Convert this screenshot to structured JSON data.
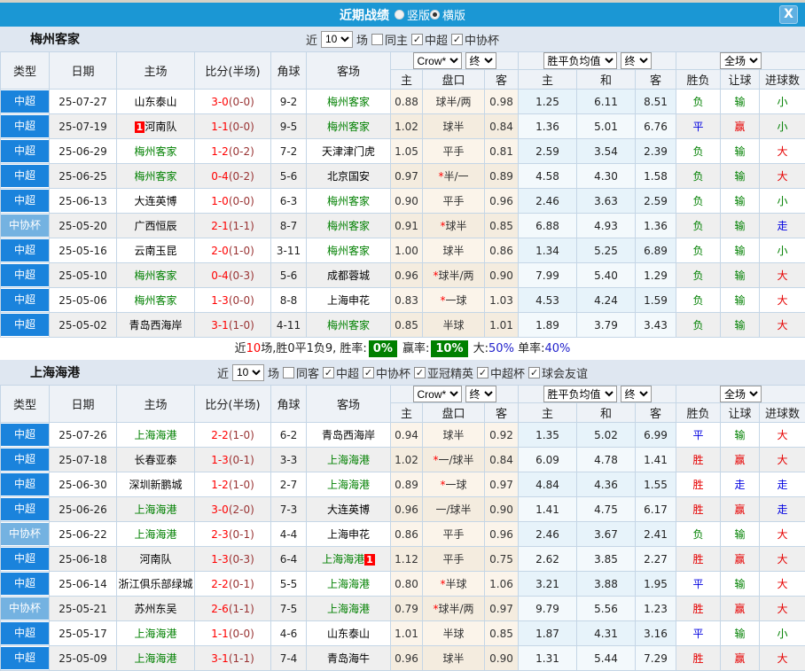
{
  "colors": {
    "titlebar": "#1b97d4",
    "league_csl": "#1a83dc",
    "league_cup": "#74b2e1",
    "team_green": "#008000",
    "score_red": "#ff0000",
    "half_red": "#993333",
    "win_red": "#e60000",
    "draw_blue": "#0000e0",
    "lose_green": "#008000",
    "summary_badge_bg": "#008000",
    "section_header_bg": "#dfe7f1"
  },
  "titlebar": {
    "title": "近期战绩",
    "radio_options": [
      {
        "label": "竖版",
        "selected": false
      },
      {
        "label": "横版",
        "selected": true
      }
    ],
    "close_icon": "X"
  },
  "columns": [
    "类型",
    "日期",
    "主场",
    "比分(半场)",
    "角球",
    "客场",
    "主",
    "盘口",
    "客",
    "主",
    "和",
    "客",
    "胜负",
    "让球",
    "进球数"
  ],
  "dropdowns": {
    "odds_provider": "Crow*",
    "odds_state": "终",
    "mean": "胜平负均值",
    "mean_state": "终",
    "scope": "全场"
  },
  "filter_labels": {
    "prefix": "近",
    "suffix": "场"
  },
  "sections": [
    {
      "team": "梅州客家",
      "filter": {
        "count": "10",
        "checks": [
          {
            "label": "同主",
            "checked": false
          },
          {
            "label": "中超",
            "checked": true
          },
          {
            "label": "中协杯",
            "checked": true
          }
        ]
      },
      "rows": [
        {
          "league": "中超",
          "cup": false,
          "date": "25-07-27",
          "home": {
            "name": "山东泰山",
            "green": false
          },
          "score": "3-0",
          "half": "(0-0)",
          "corner": "9-2",
          "away": {
            "name": "梅州客家",
            "green": true
          },
          "o1": "0.88",
          "star": false,
          "hcap": "球半/两",
          "o2": "0.98",
          "m1": "1.25",
          "m2": "6.11",
          "m3": "8.51",
          "r1": {
            "t": "负",
            "c": "green"
          },
          "r2": {
            "t": "输",
            "c": "green"
          },
          "r3": {
            "t": "小",
            "c": "green"
          }
        },
        {
          "league": "中超",
          "cup": false,
          "date": "25-07-19",
          "home": {
            "name": "河南队",
            "green": false,
            "tag": "1",
            "tagPos": "pre"
          },
          "score": "1-1",
          "half": "(0-0)",
          "corner": "9-5",
          "away": {
            "name": "梅州客家",
            "green": true
          },
          "o1": "1.02",
          "star": false,
          "hcap": "球半",
          "o2": "0.84",
          "m1": "1.36",
          "m2": "5.01",
          "m3": "6.76",
          "r1": {
            "t": "平",
            "c": "blue"
          },
          "r2": {
            "t": "赢",
            "c": "red"
          },
          "r3": {
            "t": "小",
            "c": "green"
          }
        },
        {
          "league": "中超",
          "cup": false,
          "date": "25-06-29",
          "home": {
            "name": "梅州客家",
            "green": true
          },
          "score": "1-2",
          "half": "(0-2)",
          "corner": "7-2",
          "away": {
            "name": "天津津门虎",
            "green": false
          },
          "o1": "1.05",
          "star": false,
          "hcap": "平手",
          "o2": "0.81",
          "m1": "2.59",
          "m2": "3.54",
          "m3": "2.39",
          "r1": {
            "t": "负",
            "c": "green"
          },
          "r2": {
            "t": "输",
            "c": "green"
          },
          "r3": {
            "t": "大",
            "c": "red"
          }
        },
        {
          "league": "中超",
          "cup": false,
          "date": "25-06-25",
          "home": {
            "name": "梅州客家",
            "green": true
          },
          "score": "0-4",
          "half": "(0-2)",
          "corner": "5-6",
          "away": {
            "name": "北京国安",
            "green": false
          },
          "o1": "0.97",
          "star": true,
          "hcap": "半/一",
          "o2": "0.89",
          "m1": "4.58",
          "m2": "4.30",
          "m3": "1.58",
          "r1": {
            "t": "负",
            "c": "green"
          },
          "r2": {
            "t": "输",
            "c": "green"
          },
          "r3": {
            "t": "大",
            "c": "red"
          }
        },
        {
          "league": "中超",
          "cup": false,
          "date": "25-06-13",
          "home": {
            "name": "大连英博",
            "green": false
          },
          "score": "1-0",
          "half": "(0-0)",
          "corner": "6-3",
          "away": {
            "name": "梅州客家",
            "green": true
          },
          "o1": "0.90",
          "star": false,
          "hcap": "平手",
          "o2": "0.96",
          "m1": "2.46",
          "m2": "3.63",
          "m3": "2.59",
          "r1": {
            "t": "负",
            "c": "green"
          },
          "r2": {
            "t": "输",
            "c": "green"
          },
          "r3": {
            "t": "小",
            "c": "green"
          }
        },
        {
          "league": "中协杯",
          "cup": true,
          "date": "25-05-20",
          "home": {
            "name": "广西恒辰",
            "green": false
          },
          "score": "2-1",
          "half": "(1-1)",
          "corner": "8-7",
          "away": {
            "name": "梅州客家",
            "green": true
          },
          "o1": "0.91",
          "star": true,
          "hcap": "球半",
          "o2": "0.85",
          "m1": "6.88",
          "m2": "4.93",
          "m3": "1.36",
          "r1": {
            "t": "负",
            "c": "green"
          },
          "r2": {
            "t": "输",
            "c": "green"
          },
          "r3": {
            "t": "走",
            "c": "blue"
          }
        },
        {
          "league": "中超",
          "cup": false,
          "date": "25-05-16",
          "home": {
            "name": "云南玉昆",
            "green": false
          },
          "score": "2-0",
          "half": "(1-0)",
          "corner": "3-11",
          "away": {
            "name": "梅州客家",
            "green": true
          },
          "o1": "1.00",
          "star": false,
          "hcap": "球半",
          "o2": "0.86",
          "m1": "1.34",
          "m2": "5.25",
          "m3": "6.89",
          "r1": {
            "t": "负",
            "c": "green"
          },
          "r2": {
            "t": "输",
            "c": "green"
          },
          "r3": {
            "t": "小",
            "c": "green"
          }
        },
        {
          "league": "中超",
          "cup": false,
          "date": "25-05-10",
          "home": {
            "name": "梅州客家",
            "green": true
          },
          "score": "0-4",
          "half": "(0-3)",
          "corner": "5-6",
          "away": {
            "name": "成都蓉城",
            "green": false
          },
          "o1": "0.96",
          "star": true,
          "hcap": "球半/两",
          "o2": "0.90",
          "m1": "7.99",
          "m2": "5.40",
          "m3": "1.29",
          "r1": {
            "t": "负",
            "c": "green"
          },
          "r2": {
            "t": "输",
            "c": "green"
          },
          "r3": {
            "t": "大",
            "c": "red"
          }
        },
        {
          "league": "中超",
          "cup": false,
          "date": "25-05-06",
          "home": {
            "name": "梅州客家",
            "green": true
          },
          "score": "1-3",
          "half": "(0-0)",
          "corner": "8-8",
          "away": {
            "name": "上海申花",
            "green": false
          },
          "o1": "0.83",
          "star": true,
          "hcap": "一球",
          "o2": "1.03",
          "m1": "4.53",
          "m2": "4.24",
          "m3": "1.59",
          "r1": {
            "t": "负",
            "c": "green"
          },
          "r2": {
            "t": "输",
            "c": "green"
          },
          "r3": {
            "t": "大",
            "c": "red"
          }
        },
        {
          "league": "中超",
          "cup": false,
          "date": "25-05-02",
          "home": {
            "name": "青岛西海岸",
            "green": false
          },
          "score": "3-1",
          "half": "(1-0)",
          "corner": "4-11",
          "away": {
            "name": "梅州客家",
            "green": true
          },
          "o1": "0.85",
          "star": false,
          "hcap": "半球",
          "o2": "1.01",
          "m1": "1.89",
          "m2": "3.79",
          "m3": "3.43",
          "r1": {
            "t": "负",
            "c": "green"
          },
          "r2": {
            "t": "输",
            "c": "green"
          },
          "r3": {
            "t": "大",
            "c": "red"
          }
        }
      ],
      "summary": [
        {
          "t": "近",
          "s": "plain"
        },
        {
          "t": "10",
          "s": "red"
        },
        {
          "t": "场,胜0平1负9, 胜率:",
          "s": "plain"
        },
        {
          "t": "0%",
          "s": "pct"
        },
        {
          "t": " 赢率:",
          "s": "plain"
        },
        {
          "t": "10%",
          "s": "pct"
        },
        {
          "t": " 大:",
          "s": "plain"
        },
        {
          "t": "50%",
          "s": "blue"
        },
        {
          "t": " 单率:",
          "s": "plain"
        },
        {
          "t": "40%",
          "s": "blue"
        }
      ]
    },
    {
      "team": "上海海港",
      "filter": {
        "count": "10",
        "checks": [
          {
            "label": "同客",
            "checked": false
          },
          {
            "label": "中超",
            "checked": true
          },
          {
            "label": "中协杯",
            "checked": true
          },
          {
            "label": "亚冠精英",
            "checked": true
          },
          {
            "label": "中超杯",
            "checked": true
          },
          {
            "label": "球会友谊",
            "checked": true
          }
        ]
      },
      "rows": [
        {
          "league": "中超",
          "cup": false,
          "date": "25-07-26",
          "home": {
            "name": "上海海港",
            "green": true
          },
          "score": "2-2",
          "half": "(1-0)",
          "corner": "6-2",
          "away": {
            "name": "青岛西海岸",
            "green": false
          },
          "o1": "0.94",
          "star": false,
          "hcap": "球半",
          "o2": "0.92",
          "m1": "1.35",
          "m2": "5.02",
          "m3": "6.99",
          "r1": {
            "t": "平",
            "c": "blue"
          },
          "r2": {
            "t": "输",
            "c": "green"
          },
          "r3": {
            "t": "大",
            "c": "red"
          }
        },
        {
          "league": "中超",
          "cup": false,
          "date": "25-07-18",
          "home": {
            "name": "长春亚泰",
            "green": false
          },
          "score": "1-3",
          "half": "(0-1)",
          "corner": "3-3",
          "away": {
            "name": "上海海港",
            "green": true
          },
          "o1": "1.02",
          "star": true,
          "hcap": "一/球半",
          "o2": "0.84",
          "m1": "6.09",
          "m2": "4.78",
          "m3": "1.41",
          "r1": {
            "t": "胜",
            "c": "red"
          },
          "r2": {
            "t": "赢",
            "c": "red"
          },
          "r3": {
            "t": "大",
            "c": "red"
          }
        },
        {
          "league": "中超",
          "cup": false,
          "date": "25-06-30",
          "home": {
            "name": "深圳新鹏城",
            "green": false
          },
          "score": "1-2",
          "half": "(1-0)",
          "corner": "2-7",
          "away": {
            "name": "上海海港",
            "green": true
          },
          "o1": "0.89",
          "star": true,
          "hcap": "一球",
          "o2": "0.97",
          "m1": "4.84",
          "m2": "4.36",
          "m3": "1.55",
          "r1": {
            "t": "胜",
            "c": "red"
          },
          "r2": {
            "t": "走",
            "c": "blue"
          },
          "r3": {
            "t": "走",
            "c": "blue"
          }
        },
        {
          "league": "中超",
          "cup": false,
          "date": "25-06-26",
          "home": {
            "name": "上海海港",
            "green": true
          },
          "score": "3-0",
          "half": "(2-0)",
          "corner": "7-3",
          "away": {
            "name": "大连英博",
            "green": false
          },
          "o1": "0.96",
          "star": false,
          "hcap": "一/球半",
          "o2": "0.90",
          "m1": "1.41",
          "m2": "4.75",
          "m3": "6.17",
          "r1": {
            "t": "胜",
            "c": "red"
          },
          "r2": {
            "t": "赢",
            "c": "red"
          },
          "r3": {
            "t": "走",
            "c": "blue"
          }
        },
        {
          "league": "中协杯",
          "cup": true,
          "date": "25-06-22",
          "home": {
            "name": "上海海港",
            "green": true
          },
          "score": "2-3",
          "half": "(0-1)",
          "corner": "4-4",
          "away": {
            "name": "上海申花",
            "green": false
          },
          "o1": "0.86",
          "star": false,
          "hcap": "平手",
          "o2": "0.96",
          "m1": "2.46",
          "m2": "3.67",
          "m3": "2.41",
          "r1": {
            "t": "负",
            "c": "green"
          },
          "r2": {
            "t": "输",
            "c": "green"
          },
          "r3": {
            "t": "大",
            "c": "red"
          }
        },
        {
          "league": "中超",
          "cup": false,
          "date": "25-06-18",
          "home": {
            "name": "河南队",
            "green": false
          },
          "score": "1-3",
          "half": "(0-3)",
          "corner": "6-4",
          "away": {
            "name": "上海海港",
            "green": true,
            "tag": "1",
            "tagPos": "post"
          },
          "o1": "1.12",
          "star": false,
          "hcap": "平手",
          "o2": "0.75",
          "m1": "2.62",
          "m2": "3.85",
          "m3": "2.27",
          "r1": {
            "t": "胜",
            "c": "red"
          },
          "r2": {
            "t": "赢",
            "c": "red"
          },
          "r3": {
            "t": "大",
            "c": "red"
          }
        },
        {
          "league": "中超",
          "cup": false,
          "date": "25-06-14",
          "home": {
            "name": "浙江俱乐部绿城",
            "green": false
          },
          "score": "2-2",
          "half": "(0-1)",
          "corner": "5-5",
          "away": {
            "name": "上海海港",
            "green": true
          },
          "o1": "0.80",
          "star": true,
          "hcap": "半球",
          "o2": "1.06",
          "m1": "3.21",
          "m2": "3.88",
          "m3": "1.95",
          "r1": {
            "t": "平",
            "c": "blue"
          },
          "r2": {
            "t": "输",
            "c": "green"
          },
          "r3": {
            "t": "大",
            "c": "red"
          }
        },
        {
          "league": "中协杯",
          "cup": true,
          "date": "25-05-21",
          "home": {
            "name": "苏州东吴",
            "green": false
          },
          "score": "2-6",
          "half": "(1-1)",
          "corner": "7-5",
          "away": {
            "name": "上海海港",
            "green": true
          },
          "o1": "0.79",
          "star": true,
          "hcap": "球半/两",
          "o2": "0.97",
          "m1": "9.79",
          "m2": "5.56",
          "m3": "1.23",
          "r1": {
            "t": "胜",
            "c": "red"
          },
          "r2": {
            "t": "赢",
            "c": "red"
          },
          "r3": {
            "t": "大",
            "c": "red"
          }
        },
        {
          "league": "中超",
          "cup": false,
          "date": "25-05-17",
          "home": {
            "name": "上海海港",
            "green": true
          },
          "score": "1-1",
          "half": "(0-0)",
          "corner": "4-6",
          "away": {
            "name": "山东泰山",
            "green": false
          },
          "o1": "1.01",
          "star": false,
          "hcap": "半球",
          "o2": "0.85",
          "m1": "1.87",
          "m2": "4.31",
          "m3": "3.16",
          "r1": {
            "t": "平",
            "c": "blue"
          },
          "r2": {
            "t": "输",
            "c": "green"
          },
          "r3": {
            "t": "小",
            "c": "green"
          }
        },
        {
          "league": "中超",
          "cup": false,
          "date": "25-05-09",
          "home": {
            "name": "上海海港",
            "green": true
          },
          "score": "3-1",
          "half": "(1-1)",
          "corner": "7-4",
          "away": {
            "name": "青岛海牛",
            "green": false
          },
          "o1": "0.96",
          "star": false,
          "hcap": "球半",
          "o2": "0.90",
          "m1": "1.31",
          "m2": "5.44",
          "m3": "7.29",
          "r1": {
            "t": "胜",
            "c": "red"
          },
          "r2": {
            "t": "赢",
            "c": "red"
          },
          "r3": {
            "t": "大",
            "c": "red"
          }
        }
      ],
      "summary": null
    }
  ]
}
